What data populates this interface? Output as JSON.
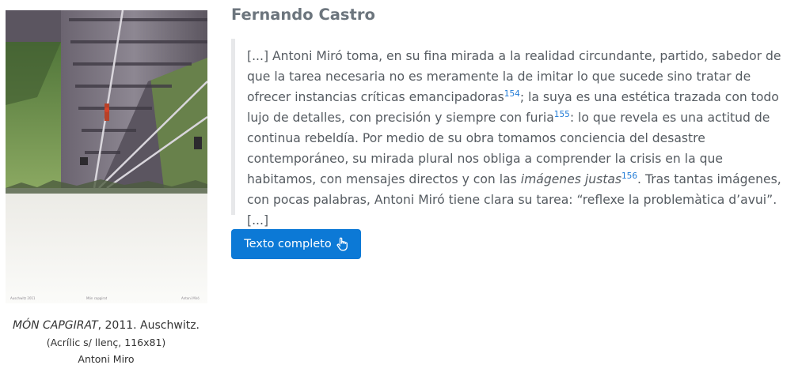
{
  "artwork": {
    "alt": "Món capgirat, Auschwitz — obra d'Antoni Miró",
    "signature_left": "Auschwitz 2011",
    "signature_center": "Món capgirat",
    "signature_right": "Antoni Miró"
  },
  "caption": {
    "title": "MÓN CAPGIRAT",
    "year_place": ", 2011. Auschwitz.",
    "medium": "(Acrílic s/ llenç, 116x81)",
    "artist": "Antoni Miro"
  },
  "author": "Fernando Castro",
  "quote": {
    "p1": "[...] Antoni Miró toma, en su fina mirada a la realidad circundante, partido, sabedor de que la tarea necesaria no es meramente la de imitar lo que sucede sino tratar de ofrecer instancias críticas emancipadoras",
    "ref1": "154",
    "p2": "; la suya es una estética trazada con todo lujo de detalles, con precisión y siempre con furia",
    "ref2": "155",
    "p3": ": lo que revela es una actitud de continua rebeldía. Por medio de su obra tomamos conciencia del desastre contemporáneo, su mirada plural nos obliga a comprender la crisis en la que habitamos, con mensajes directos y con las ",
    "emph": "imágenes justas",
    "ref3": "156",
    "p4": ". Tras tantas imágenes, con pocas palabras, Antoni Miró tiene clara su tarea: “reflexe la problemàtica d’avui”. [...]"
  },
  "button": {
    "label": "Texto completo",
    "icon": "hand-pointer-icon"
  },
  "colors": {
    "accent": "#0c79d6",
    "sup": "#1f7ad6",
    "heading": "#6c757d",
    "quote_border": "#e7e8ea"
  }
}
